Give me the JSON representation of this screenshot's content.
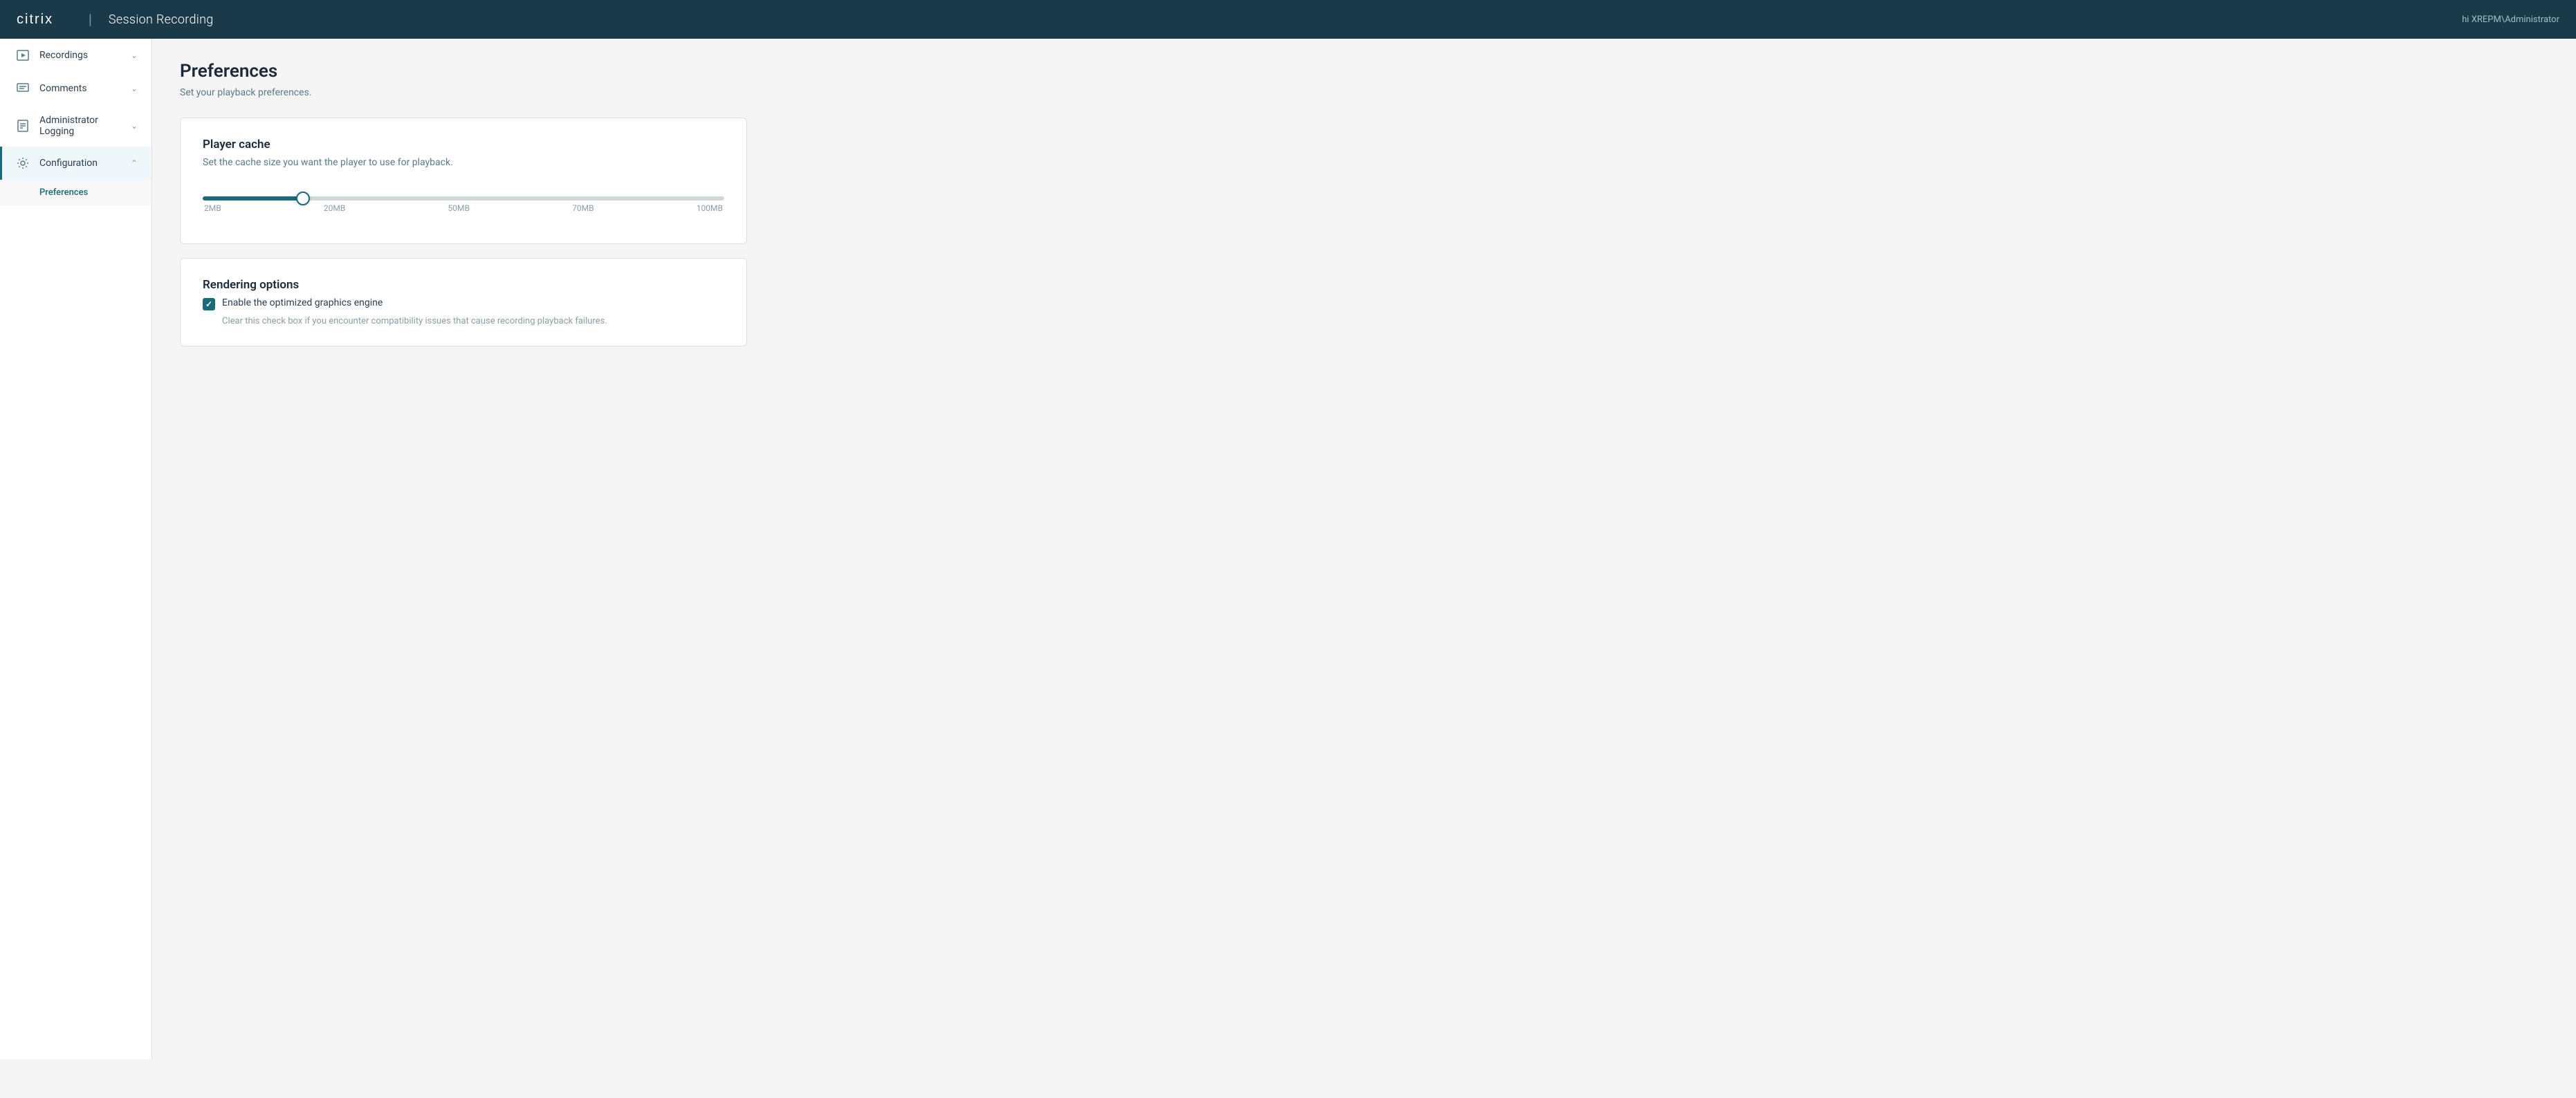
{
  "header": {
    "logo": "citrix",
    "separator": "|",
    "app_name": "Session Recording",
    "user_greeting": "hi",
    "user_name": "XREPM\\Administrator"
  },
  "sidebar": {
    "items": [
      {
        "id": "recordings",
        "label": "Recordings",
        "icon": "recordings-icon",
        "expanded": true,
        "active": false,
        "has_children": true
      },
      {
        "id": "comments",
        "label": "Comments",
        "icon": "comments-icon",
        "expanded": false,
        "active": false,
        "has_children": true
      },
      {
        "id": "administrator-logging",
        "label": "Administrator Logging",
        "icon": "admin-logging-icon",
        "expanded": false,
        "active": false,
        "has_children": true
      },
      {
        "id": "configuration",
        "label": "Configuration",
        "icon": "configuration-icon",
        "expanded": true,
        "active": true,
        "has_children": true
      }
    ],
    "sub_items": [
      {
        "id": "preferences",
        "label": "Preferences",
        "parent": "configuration",
        "active": true
      }
    ]
  },
  "main": {
    "page_title": "Preferences",
    "page_subtitle": "Set your playback preferences.",
    "cards": {
      "player_cache": {
        "title": "Player cache",
        "description": "Set the cache size you want the player to use for playback.",
        "slider": {
          "min": 2,
          "max": 100,
          "current": 20,
          "labels": [
            "2MB",
            "20MB",
            "50MB",
            "70MB",
            "100MB"
          ]
        }
      },
      "rendering_options": {
        "title": "Rendering options",
        "checkbox": {
          "label": "Enable the optimized graphics engine",
          "checked": true,
          "hint": "Clear this check box if you encounter compatibility issues that cause recording playback failures."
        }
      }
    }
  }
}
